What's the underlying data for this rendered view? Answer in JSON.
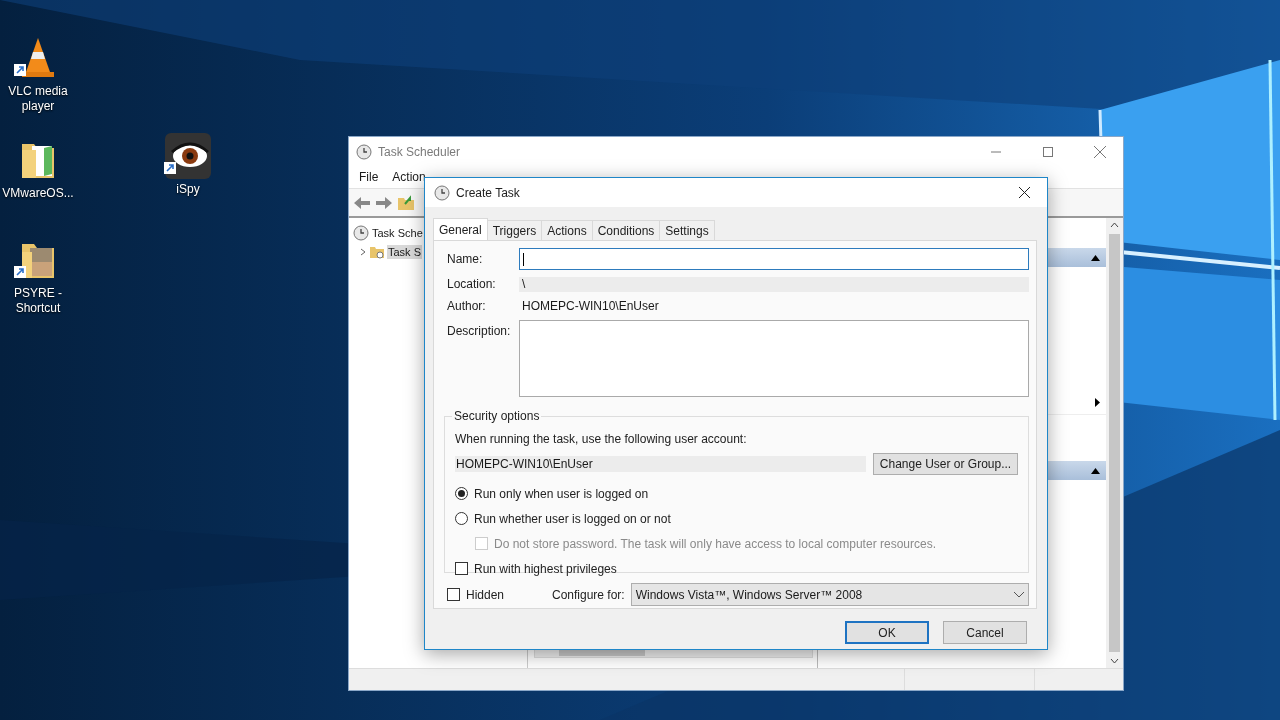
{
  "desktop_icons": [
    {
      "kind": "cone",
      "label": "VLC media player"
    },
    {
      "kind": "folder",
      "label": "VMwareOS..."
    },
    {
      "kind": "eye",
      "label": "iSpy"
    },
    {
      "kind": "photo-folder",
      "label": "PSYRE - Shortcut"
    }
  ],
  "main_window": {
    "title": "Task Scheduler",
    "menu": [
      "File",
      "Action"
    ],
    "tree": [
      {
        "label": "Task Sche",
        "selected": false,
        "children": [
          {
            "label": "Task S",
            "selected": true,
            "expanded": false
          }
        ]
      }
    ]
  },
  "dialog": {
    "title": "Create Task",
    "tabs": [
      {
        "label": "General",
        "selected": true
      },
      {
        "label": "Triggers",
        "selected": false
      },
      {
        "label": "Actions",
        "selected": false
      },
      {
        "label": "Conditions",
        "selected": false
      },
      {
        "label": "Settings",
        "selected": false
      }
    ],
    "name": {
      "label": "Name:",
      "focused": true
    },
    "location": {
      "label": "Location:",
      "value": "\\"
    },
    "author": {
      "label": "Author:",
      "value": "HOMEPC-WIN10\\EnUser"
    },
    "description": {
      "label": "Description:"
    },
    "security": {
      "title": "Security options",
      "prompt": "When running the task, use the following user account:",
      "account": "HOMEPC-WIN10\\EnUser",
      "change_button": "Change User or Group...",
      "options": [
        {
          "kind": "radio",
          "label": "Run only when user is logged on",
          "checked": true,
          "disabled": false
        },
        {
          "kind": "radio",
          "label": "Run whether user is logged on or not",
          "checked": false,
          "disabled": false,
          "children": [
            {
              "kind": "checkbox",
              "label": "Do not store password.  The task will only have access to local computer resources.",
              "checked": false,
              "disabled": true
            }
          ]
        },
        {
          "kind": "checkbox",
          "label": "Run with highest privileges",
          "checked": false,
          "disabled": false
        }
      ]
    },
    "hidden": {
      "label": "Hidden",
      "checked": false
    },
    "configure_for": {
      "label": "Configure for:",
      "value": "Windows Vista™, Windows Server™ 2008"
    },
    "buttons": [
      {
        "label": "OK",
        "default": true
      },
      {
        "label": "Cancel",
        "default": false
      }
    ]
  }
}
